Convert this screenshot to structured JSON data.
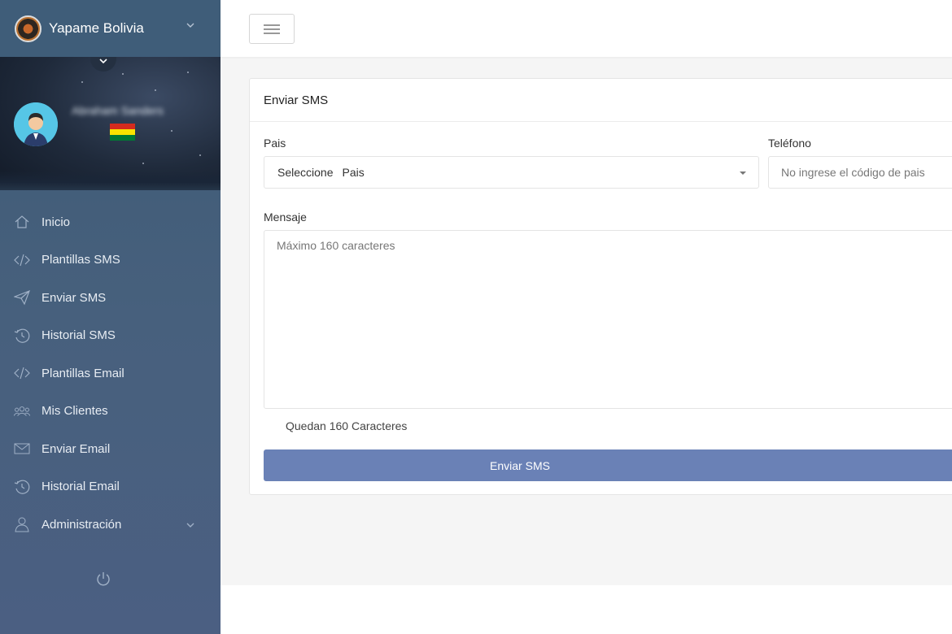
{
  "brand": {
    "name": "Yapame Bolivia"
  },
  "user": {
    "name": "Abraham Sanders"
  },
  "flag_colors": [
    "#d52b1e",
    "#f9e300",
    "#007934"
  ],
  "sidebar": {
    "items": [
      {
        "label": "Inicio",
        "icon": "home-icon"
      },
      {
        "label": "Plantillas SMS",
        "icon": "code-icon"
      },
      {
        "label": "Enviar SMS",
        "icon": "paper-plane-icon"
      },
      {
        "label": "Historial SMS",
        "icon": "history-icon"
      },
      {
        "label": "Plantillas Email",
        "icon": "code-icon"
      },
      {
        "label": "Mis Clientes",
        "icon": "users-icon"
      },
      {
        "label": "Enviar Email",
        "icon": "envelope-icon"
      },
      {
        "label": "Historial Email",
        "icon": "history-icon"
      },
      {
        "label": "Administración",
        "icon": "user-icon"
      }
    ]
  },
  "card": {
    "title": "Enviar SMS",
    "pais_label": "Pais",
    "pais_select_prefix": "Seleccione",
    "pais_select_value": "Pais",
    "telefono_label": "Teléfono",
    "telefono_placeholder": "No ingrese el código de pais",
    "mensaje_label": "Mensaje",
    "mensaje_placeholder": "Máximo 160 caracteres",
    "counter": "Quedan 160 Caracteres",
    "send_label": "Enviar SMS"
  },
  "colors": {
    "accent": "#6a81b6",
    "sidebar": "#47607d"
  }
}
